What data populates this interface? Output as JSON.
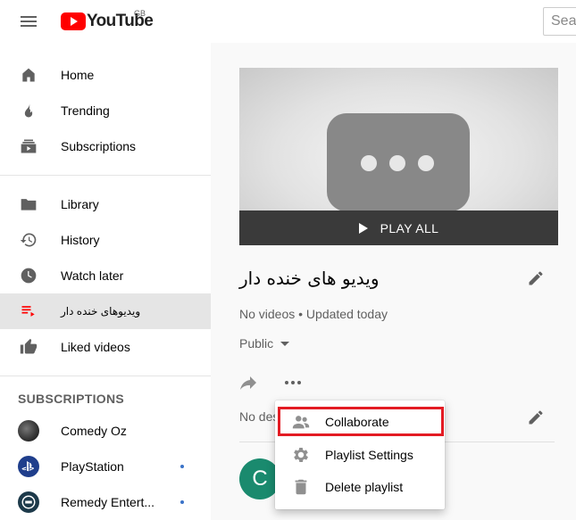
{
  "header": {
    "logo_text": "YouTube",
    "country": "GB",
    "search_placeholder": "Search"
  },
  "sidebar": {
    "main": [
      {
        "label": "Home",
        "icon": "home-icon"
      },
      {
        "label": "Trending",
        "icon": "trending-icon"
      },
      {
        "label": "Subscriptions",
        "icon": "subscriptions-icon"
      }
    ],
    "library": [
      {
        "label": "Library",
        "icon": "folder-icon"
      },
      {
        "label": "History",
        "icon": "history-icon"
      },
      {
        "label": "Watch later",
        "icon": "clock-icon"
      },
      {
        "label": "ویدیوهای خنده دار",
        "icon": "playlist-icon"
      },
      {
        "label": "Liked videos",
        "icon": "thumbs-up-icon"
      }
    ],
    "subscriptions_title": "SUBSCRIPTIONS",
    "channels": [
      {
        "label": "Comedy Oz"
      },
      {
        "label": "PlayStation"
      },
      {
        "label": "Remedy Entert..."
      }
    ]
  },
  "playlist": {
    "play_all": "PLAY ALL",
    "title": "ویدیو های خنده دار",
    "meta": "No videos • Updated today",
    "privacy": "Public",
    "description": "No description",
    "owner_initial": "C"
  },
  "menu": {
    "items": [
      {
        "label": "Collaborate",
        "icon": "collaborate-icon"
      },
      {
        "label": "Playlist Settings",
        "icon": "gear-icon"
      },
      {
        "label": "Delete playlist",
        "icon": "trash-icon"
      }
    ]
  },
  "colors": {
    "brand_red": "#ff0000",
    "highlight_red": "#e31b23",
    "active_playlist_icon": "#ff0000",
    "owner_avatar": "#1a8a6e"
  }
}
